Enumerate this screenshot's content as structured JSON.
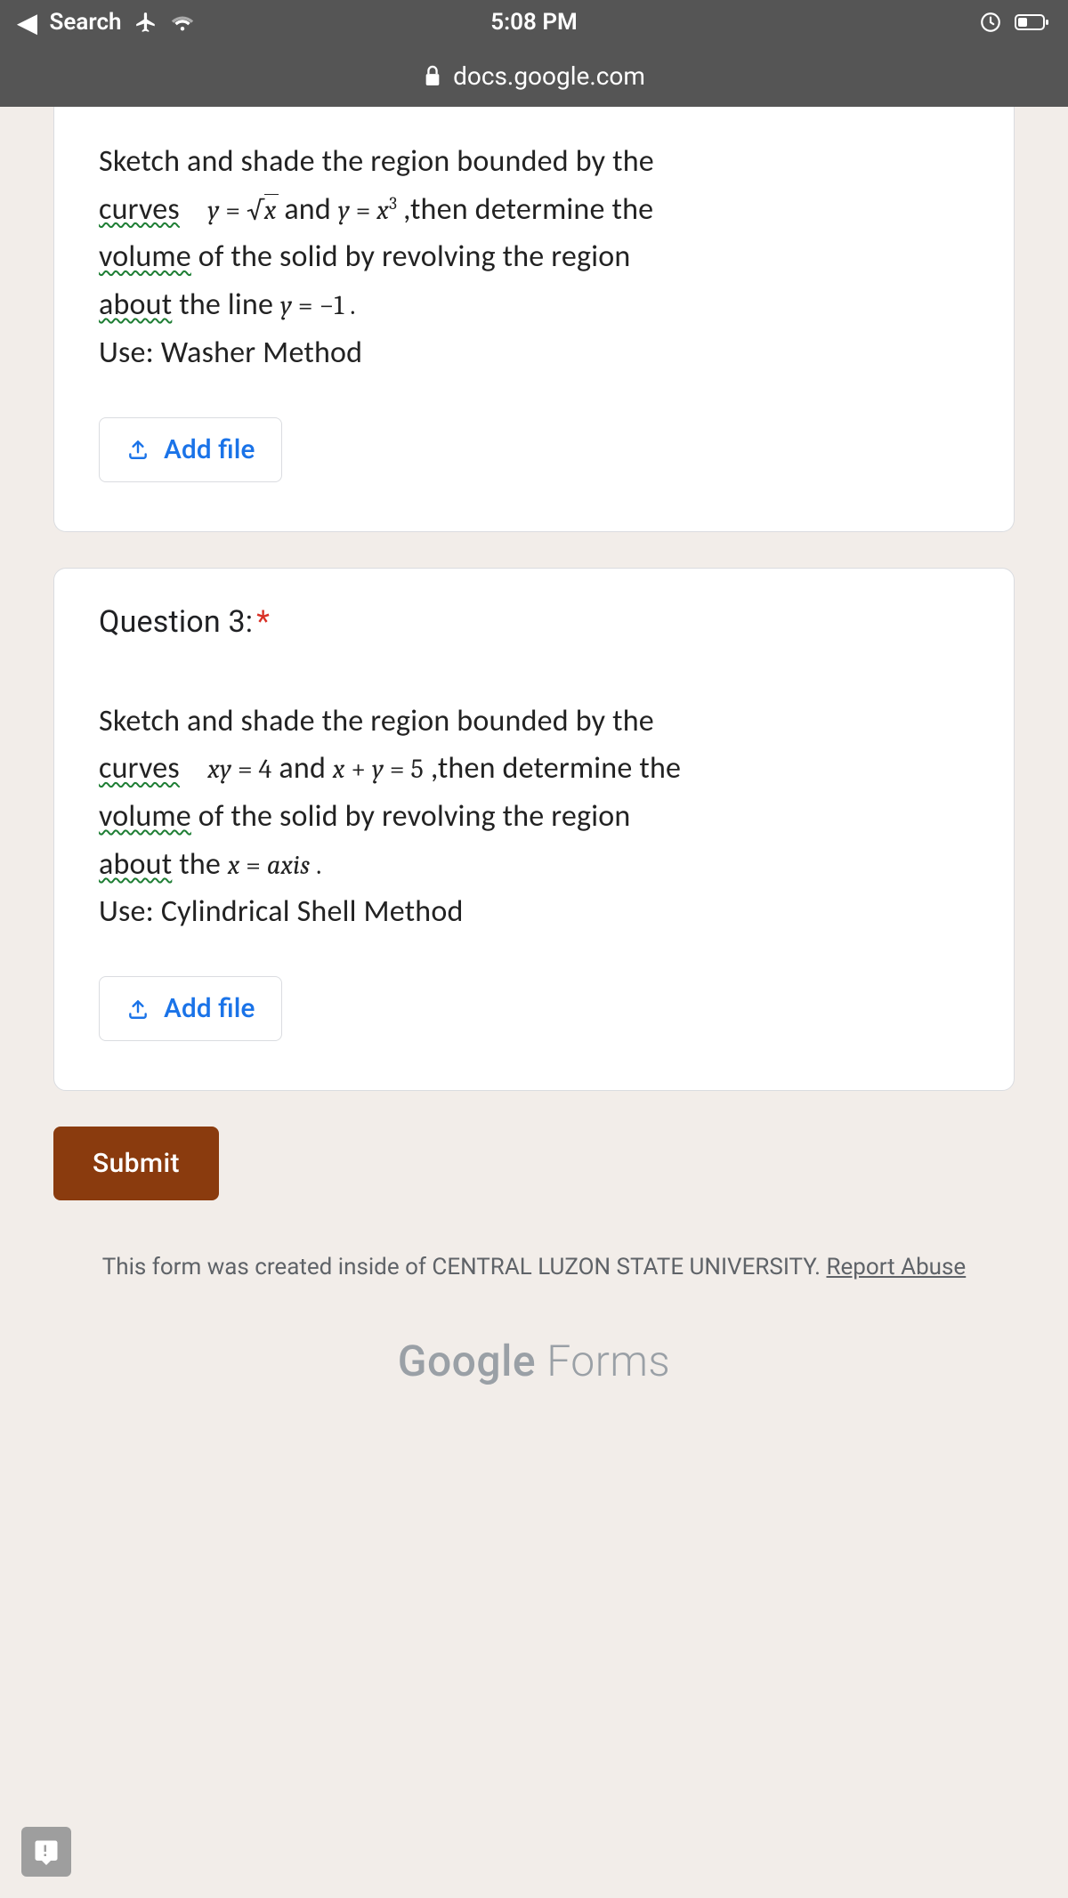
{
  "status_bar": {
    "back_label": "Search",
    "time": "5:08 PM"
  },
  "url_bar": {
    "domain": "docs.google.com"
  },
  "question2": {
    "body_line1_pre": "Sketch and shade the region bounded by the",
    "curves_word": "curves",
    "eq1_lhs": "y",
    "eq1_op": " = ",
    "eq1_sqrt_arg": "x",
    "between_and": " and ",
    "eq2_lhs": "y",
    "eq2_op": " = ",
    "eq2_rhs_base": "x",
    "eq2_rhs_exp": "3",
    "after_eq2": " ,then determine the",
    "volume_word": "volume",
    "line3_rest": " of the solid by revolving the region",
    "about_word": "about",
    "line4_rest": " the line ",
    "eq3": "y = −1 .",
    "method_line": "Use: Washer Method",
    "add_file_label": "Add file"
  },
  "question3": {
    "title": "Question 3:",
    "body_line1_pre": "Sketch and shade the region bounded by the",
    "curves_word": "curves",
    "eq1": "xy = 4",
    "between_and": " and ",
    "eq2": "x + y = 5",
    "after_eq2": " ,then determine the",
    "volume_word": "volume",
    "line3_rest": " of the solid by revolving the region",
    "about_word": "about",
    "line4_rest": " the ",
    "eq3": "x = axis .",
    "method_line": "Use: Cylindrical Shell Method",
    "add_file_label": "Add file"
  },
  "submit_label": "Submit",
  "footer": {
    "text_pre": "This form was created inside of CENTRAL LUZON STATE UNIVERSITY. ",
    "report_label": "Report Abuse"
  },
  "logo": {
    "google": "Google",
    "forms": " Forms"
  }
}
